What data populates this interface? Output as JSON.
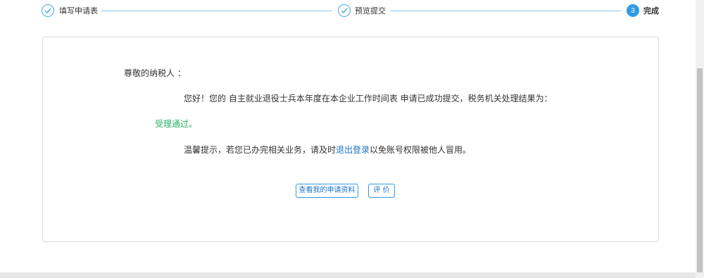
{
  "steps": [
    {
      "label": "填写申请表",
      "status": "done"
    },
    {
      "label": "预览提交",
      "status": "done"
    },
    {
      "label": "完成",
      "status": "active",
      "number": "3"
    }
  ],
  "message": {
    "greeting": "尊敬的纳税人 ：",
    "body": "您好！您的 自主就业退役士兵本年度在本企业工作时间表 申请已成功提交，税务机关处理结果为：",
    "result": "受理通过。",
    "tip_prefix": "温馨提示，若您已办完相关业务，请及时",
    "tip_link": "退出登录",
    "tip_suffix": "以免账号权限被他人冒用。"
  },
  "buttons": {
    "view_label": "查看我的申请资料",
    "rate_label": "评 价"
  },
  "colors": {
    "accent": "#2e9be3",
    "success": "#27ae60",
    "link": "#1a73c8"
  }
}
